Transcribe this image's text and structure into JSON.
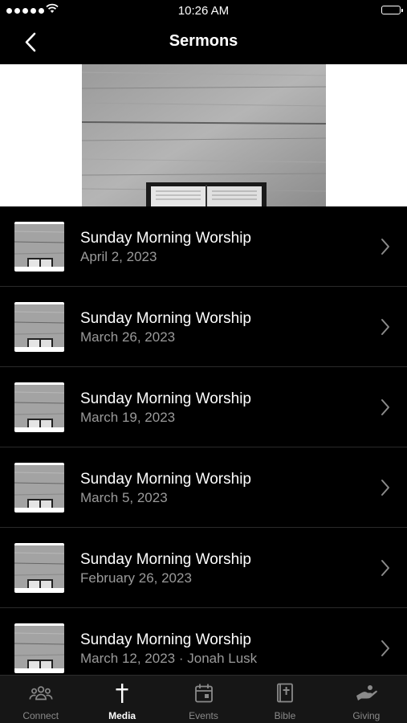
{
  "status_bar": {
    "time": "10:26 AM"
  },
  "nav": {
    "title": "Sermons"
  },
  "sermons": [
    {
      "title": "Sunday Morning Worship",
      "subtitle": "April 2, 2023"
    },
    {
      "title": "Sunday Morning Worship",
      "subtitle": "March 26, 2023"
    },
    {
      "title": "Sunday Morning Worship",
      "subtitle": "March 19, 2023"
    },
    {
      "title": "Sunday Morning Worship",
      "subtitle": "March 5, 2023"
    },
    {
      "title": "Sunday Morning Worship",
      "subtitle": "February 26, 2023"
    },
    {
      "title": "Sunday Morning Worship",
      "subtitle": "March 12, 2023 · Jonah Lusk"
    }
  ],
  "tabs": [
    {
      "label": "Connect",
      "icon": "people-icon"
    },
    {
      "label": "Media",
      "icon": "cross-icon"
    },
    {
      "label": "Events",
      "icon": "calendar-icon"
    },
    {
      "label": "Bible",
      "icon": "bible-icon"
    },
    {
      "label": "Giving",
      "icon": "giving-hand-icon"
    }
  ],
  "colors": {
    "background": "#000000",
    "tab_bar": "#161616",
    "subtitle": "#9a9a9a",
    "tab_inactive": "#8a8a8a"
  }
}
